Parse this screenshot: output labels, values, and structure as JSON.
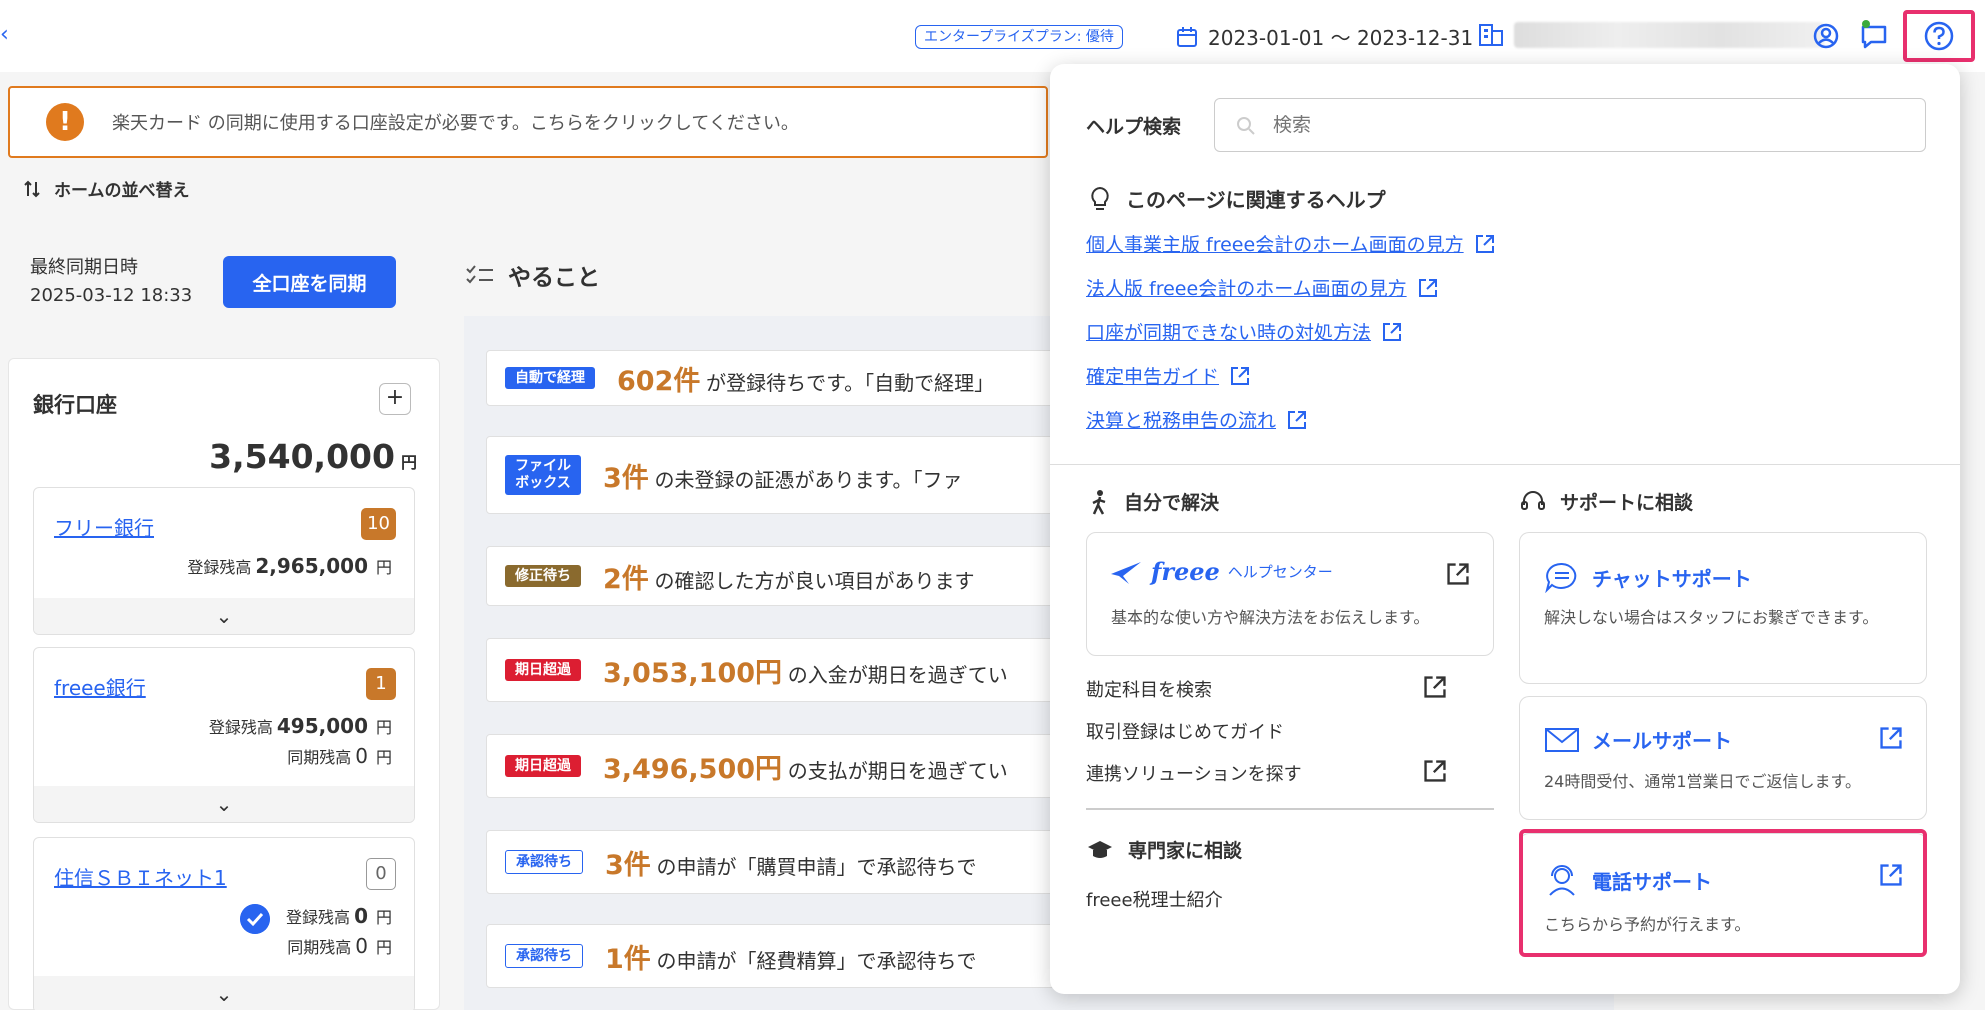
{
  "header": {
    "back_glyph": "‹",
    "plan_badge": "エンタープライズプラン: 優待",
    "date_range": "2023-01-01 〜 2023-12-31"
  },
  "alert": {
    "icon": "!",
    "text": "楽天カード の同期に使用する口座設定が必要です。こちらをクリックしてください。"
  },
  "sort_home": "ホームの並べ替え",
  "sync": {
    "label_line1": "最終同期日時",
    "label_line2": "2025-03-12 18:33",
    "button": "全口座を同期"
  },
  "bank": {
    "title": "銀行口座",
    "add": "+",
    "total": "3,540,000",
    "yen": "円",
    "accounts": [
      {
        "name": "フリー銀行",
        "count": "10",
        "reg_label": "登録残高",
        "reg_value": "2,965,000",
        "yen": "円",
        "expand": "⌄"
      },
      {
        "name": "freee銀行",
        "count": "1",
        "reg_label": "登録残高",
        "reg_value": "495,000",
        "sync_label": "同期残高",
        "sync_value": "0",
        "yen": "円",
        "expand": "⌄"
      },
      {
        "name": "住信ＳＢＩネット1",
        "count": "0",
        "reg_label": "登録残高",
        "reg_value": "0",
        "sync_label": "同期残高",
        "sync_value": "0",
        "yen": "円",
        "expand": "⌄"
      }
    ]
  },
  "todo": {
    "title": "やること",
    "items": [
      {
        "tag": "自動で経理",
        "amount": "602件",
        "text": "が登録待ちです。「自動で経理」"
      },
      {
        "tag": "ファイル\nボックス",
        "amount": "3件",
        "text": "の未登録の証憑があります。「ファ"
      },
      {
        "tag": "修正待ち",
        "amount": "2件",
        "text": "の確認した方が良い項目があります"
      },
      {
        "tag": "期日超過",
        "amount": "3,053,100円",
        "text": "の入金が期日を過ぎてい"
      },
      {
        "tag": "期日超過",
        "amount": "3,496,500円",
        "text": "の支払が期日を過ぎてい"
      },
      {
        "tag": "承認待ち",
        "amount": "3件",
        "text": "の申請が「購買申請」で承認待ちで"
      },
      {
        "tag": "承認待ち",
        "amount": "1件",
        "text": "の申請が「経費精算」で承認待ちで"
      }
    ]
  },
  "help": {
    "search_label": "ヘルプ検索",
    "search_placeholder": "検索",
    "related_title": "このページに関連するヘルプ",
    "related_links": [
      "個人事業主版 freee会計のホーム画面の見方",
      "法人版 freee会計のホーム画面の見方",
      "口座が同期できない時の対処方法",
      "確定申告ガイド",
      "決算と税務申告の流れ"
    ],
    "self_title": "自分で解決",
    "helpcenter_logo": "freee",
    "helpcenter_name": "ヘルプセンター",
    "helpcenter_desc": "基本的な使い方や解決方法をお伝えします。",
    "self_links": [
      "勘定科目を検索",
      "取引登録はじめてガイド",
      "連携ソリューションを探す"
    ],
    "expert_title": "専門家に相談",
    "expert_link": "freee税理士紹介",
    "support_title": "サポートに相談",
    "chat_title": "チャットサポート",
    "chat_desc": "解決しない場合はスタッフにお繋ぎできます。",
    "mail_title": "メールサポート",
    "mail_desc": "24時間受付、通常1営業日でご返信します。",
    "tel_title": "電話サポート",
    "tel_desc": "こちらから予約が行えます。"
  },
  "colors": {
    "accent": "#2864f0",
    "warning": "#e07a1e",
    "danger": "#dc1e32",
    "highlight": "#e8306e"
  }
}
